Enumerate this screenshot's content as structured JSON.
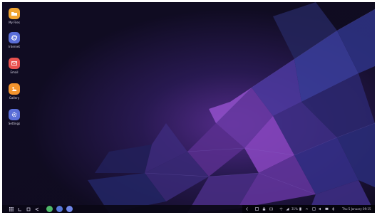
{
  "desktop": {
    "icons": [
      {
        "label": "My Files",
        "icon": "folder-icon",
        "color": "#f0a431"
      },
      {
        "label": "Internet",
        "icon": "internet-icon",
        "color": "#5a6ed8"
      },
      {
        "label": "Email",
        "icon": "email-icon",
        "color": "#e8514f"
      },
      {
        "label": "Gallery",
        "icon": "gallery-icon",
        "color": "#f3942e"
      },
      {
        "label": "Settings",
        "icon": "gear-icon",
        "color": "#5a6ed8"
      }
    ]
  },
  "taskbar": {
    "nav_buttons": [
      "apps-grid-icon",
      "back-icon",
      "home-icon",
      "recents-icon"
    ],
    "pinned_apps": [
      {
        "icon": "phone-app-icon",
        "color": "#4fb86a"
      },
      {
        "icon": "internet-app-icon",
        "color": "#5677d8"
      },
      {
        "icon": "messages-app-icon",
        "color": "#6f86e8"
      }
    ],
    "tray": {
      "icons": [
        "chevron-left-icon",
        "screenshot-icon",
        "lock-icon",
        "keyboard-icon",
        "wifi-icon",
        "signal-icon"
      ],
      "battery": "31%",
      "icons_right": [
        "notification-icon",
        "volume-icon",
        "dex-icon",
        "bluetooth-icon"
      ],
      "datetime": "Thu 5 January 09:15"
    }
  },
  "colors": {
    "wallpaper_dark": "#0f0b20",
    "wallpaper_accent": "#7a3fb8",
    "wallpaper_blue": "#3c4aa8"
  }
}
